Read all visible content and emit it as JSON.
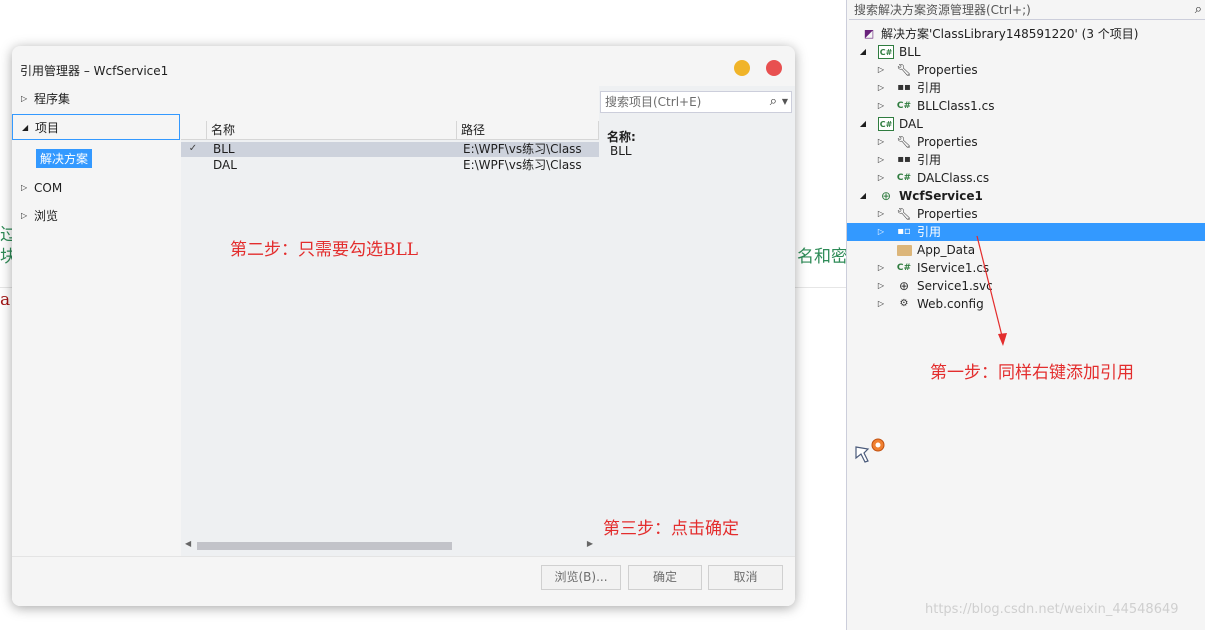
{
  "background": {
    "frag_a": "过",
    "frag_b": "块",
    "frag_c": "a",
    "frag_d": "名和密"
  },
  "solution_explorer": {
    "search_placeholder": "搜索解决方案资源管理器(Ctrl+;)",
    "solution": "解决方案'ClassLibrary148591220' (3 个项目)",
    "projects": [
      {
        "name": "BLL",
        "children": [
          "Properties",
          "引用",
          "BLLClass1.cs"
        ]
      },
      {
        "name": "DAL",
        "children": [
          "Properties",
          "引用",
          "DALClass.cs"
        ]
      },
      {
        "name": "WcfService1",
        "children": [
          "Properties",
          "引用",
          "App_Data",
          "IService1.cs",
          "Service1.svc",
          "Web.config"
        ]
      }
    ],
    "selected_item": "引用"
  },
  "annotations": {
    "step1": "第一步：同样右键添加引用",
    "step2": "第二步：只需要勾选BLL",
    "step3": "第三步：点击确定"
  },
  "dialog": {
    "title": "引用管理器 – WcfService1",
    "nav": [
      "程序集",
      "项目",
      "COM",
      "浏览"
    ],
    "nav_sub": "解决方案",
    "search_placeholder": "搜索项目(Ctrl+E)",
    "columns": [
      "名称",
      "路径"
    ],
    "rows": [
      {
        "checked": true,
        "name": "BLL",
        "path": "E:\\WPF\\vs练习\\Class"
      },
      {
        "checked": false,
        "name": "DAL",
        "path": "E:\\WPF\\vs练习\\Class"
      }
    ],
    "detail_label": "名称:",
    "detail_value": "BLL",
    "buttons": {
      "browse": "浏览(B)...",
      "ok": "确定",
      "cancel": "取消"
    }
  },
  "watermark": "https://blog.csdn.net/weixin_44548649",
  "colors": {
    "accent": "#3399ff",
    "annotation": "#e32d2d",
    "min_button": "#f0b429",
    "close_button": "#e85050"
  }
}
